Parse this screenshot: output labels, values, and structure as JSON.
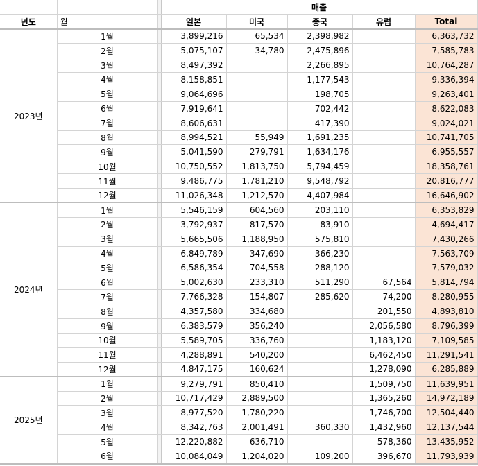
{
  "header": {
    "sales_label": "매출",
    "col_year": "년도",
    "col_month": "월",
    "col_japan": "일본",
    "col_usa": "미국",
    "col_china": "중국",
    "col_europe": "유럽",
    "col_total": "Total"
  },
  "groups": [
    {
      "year": "2023년",
      "rows": [
        {
          "month": "1월",
          "japan": "3,899,216",
          "usa": "65,534",
          "china": "2,398,982",
          "europe": "",
          "total": "6,363,732"
        },
        {
          "month": "2월",
          "japan": "5,075,107",
          "usa": "34,780",
          "china": "2,475,896",
          "europe": "",
          "total": "7,585,783"
        },
        {
          "month": "3월",
          "japan": "8,497,392",
          "usa": "",
          "china": "2,266,895",
          "europe": "",
          "total": "10,764,287"
        },
        {
          "month": "4월",
          "japan": "8,158,851",
          "usa": "",
          "china": "1,177,543",
          "europe": "",
          "total": "9,336,394"
        },
        {
          "month": "5월",
          "japan": "9,064,696",
          "usa": "",
          "china": "198,705",
          "europe": "",
          "total": "9,263,401"
        },
        {
          "month": "6월",
          "japan": "7,919,641",
          "usa": "",
          "china": "702,442",
          "europe": "",
          "total": "8,622,083"
        },
        {
          "month": "7월",
          "japan": "8,606,631",
          "usa": "",
          "china": "417,390",
          "europe": "",
          "total": "9,024,021"
        },
        {
          "month": "8월",
          "japan": "8,994,521",
          "usa": "55,949",
          "china": "1,691,235",
          "europe": "",
          "total": "10,741,705"
        },
        {
          "month": "9월",
          "japan": "5,041,590",
          "usa": "279,791",
          "china": "1,634,176",
          "europe": "",
          "total": "6,955,557"
        },
        {
          "month": "10월",
          "japan": "10,750,552",
          "usa": "1,813,750",
          "china": "5,794,459",
          "europe": "",
          "total": "18,358,761"
        },
        {
          "month": "11월",
          "japan": "9,486,775",
          "usa": "1,781,210",
          "china": "9,548,792",
          "europe": "",
          "total": "20,816,777"
        },
        {
          "month": "12월",
          "japan": "11,026,348",
          "usa": "1,212,570",
          "china": "4,407,984",
          "europe": "",
          "total": "16,646,902"
        }
      ]
    },
    {
      "year": "2024년",
      "rows": [
        {
          "month": "1월",
          "japan": "5,546,159",
          "usa": "604,560",
          "china": "203,110",
          "europe": "",
          "total": "6,353,829"
        },
        {
          "month": "2월",
          "japan": "3,792,937",
          "usa": "817,570",
          "china": "83,910",
          "europe": "",
          "total": "4,694,417"
        },
        {
          "month": "3월",
          "japan": "5,665,506",
          "usa": "1,188,950",
          "china": "575,810",
          "europe": "",
          "total": "7,430,266"
        },
        {
          "month": "4월",
          "japan": "6,849,789",
          "usa": "347,690",
          "china": "366,230",
          "europe": "",
          "total": "7,563,709"
        },
        {
          "month": "5월",
          "japan": "6,586,354",
          "usa": "704,558",
          "china": "288,120",
          "europe": "",
          "total": "7,579,032"
        },
        {
          "month": "6월",
          "japan": "5,002,630",
          "usa": "233,310",
          "china": "511,290",
          "europe": "67,564",
          "total": "5,814,794"
        },
        {
          "month": "7월",
          "japan": "7,766,328",
          "usa": "154,807",
          "china": "285,620",
          "europe": "74,200",
          "total": "8,280,955"
        },
        {
          "month": "8월",
          "japan": "4,357,580",
          "usa": "334,680",
          "china": "",
          "europe": "201,550",
          "total": "4,893,810"
        },
        {
          "month": "9월",
          "japan": "6,383,579",
          "usa": "356,240",
          "china": "",
          "europe": "2,056,580",
          "total": "8,796,399"
        },
        {
          "month": "10월",
          "japan": "5,589,705",
          "usa": "336,760",
          "china": "",
          "europe": "1,183,120",
          "total": "7,109,585"
        },
        {
          "month": "11월",
          "japan": "4,288,891",
          "usa": "540,200",
          "china": "",
          "europe": "6,462,450",
          "total": "11,291,541"
        },
        {
          "month": "12월",
          "japan": "4,847,175",
          "usa": "160,624",
          "china": "",
          "europe": "1,278,090",
          "total": "6,285,889"
        }
      ]
    },
    {
      "year": "2025년",
      "rows": [
        {
          "month": "1월",
          "japan": "9,279,791",
          "usa": "850,410",
          "china": "",
          "europe": "1,509,750",
          "total": "11,639,951"
        },
        {
          "month": "2월",
          "japan": "10,717,429",
          "usa": "2,889,500",
          "china": "",
          "europe": "1,365,260",
          "total": "14,972,189"
        },
        {
          "month": "3월",
          "japan": "8,977,520",
          "usa": "1,780,220",
          "china": "",
          "europe": "1,746,700",
          "total": "12,504,440"
        },
        {
          "month": "4월",
          "japan": "8,342,763",
          "usa": "2,001,491",
          "china": "360,330",
          "europe": "1,432,960",
          "total": "12,137,544"
        },
        {
          "month": "5월",
          "japan": "12,220,882",
          "usa": "636,710",
          "china": "",
          "europe": "578,360",
          "total": "13,435,952"
        },
        {
          "month": "6월",
          "japan": "10,084,049",
          "usa": "1,204,020",
          "china": "109,200",
          "europe": "396,670",
          "total": "11,793,939"
        }
      ]
    }
  ]
}
